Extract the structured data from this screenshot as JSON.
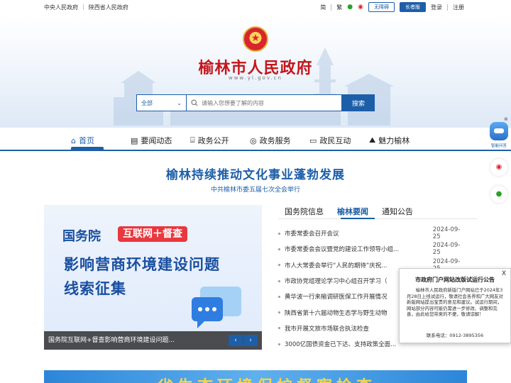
{
  "topbar": {
    "links": [
      "中央人民政府",
      "陕西省人民政府"
    ],
    "lang_simplified": "简",
    "lang_traditional": "繁",
    "icons": [
      "wechat-icon",
      "weibo-icon"
    ],
    "accessibility": "无障碍",
    "elderly": "长者版",
    "login": "登录",
    "register": "注册"
  },
  "header": {
    "site_title": "榆林市人民政府",
    "site_url": "www.yl.gov.cn",
    "search": {
      "scope": "全部",
      "placeholder": "请输入您想要了解的内容",
      "button": "搜索"
    }
  },
  "nav": {
    "items": [
      {
        "label": "首页",
        "icon": "home-icon"
      },
      {
        "label": "要闻动态",
        "icon": "news-icon"
      },
      {
        "label": "政务公开",
        "icon": "gov-icon"
      },
      {
        "label": "政务服务",
        "icon": "service-icon"
      },
      {
        "label": "政民互动",
        "icon": "chat-icon"
      },
      {
        "label": "魅力榆林",
        "icon": "scenery-icon"
      }
    ],
    "active_index": 0
  },
  "main": {
    "headline": "榆林持续推动文化事业蓬勃发展",
    "subhead": "中共榆林市委五届七次全会举行"
  },
  "feature": {
    "line1": "国务院",
    "pill": "互联网＋督查",
    "line2": "影响营商环境建设问题",
    "line3": "线索征集",
    "caption": "国务院互联网+督查影响营商环境建设问题...",
    "prev": "‹",
    "next": "›"
  },
  "news": {
    "tabs": [
      "国务院信息",
      "榆林要闻",
      "通知公告"
    ],
    "active_tab": 1,
    "items": [
      {
        "title": "市委常委会召开会议",
        "date": "2024-09-25"
      },
      {
        "title": "市委常委会会议暨党的建设工作领导小组...",
        "date": "2024-09-25"
      },
      {
        "title": "市人大常委会举行“人民的期待”庆祝...",
        "date": "2024-09-25"
      },
      {
        "title": "市政协党组理论学习中心组召开学习（",
        "date": ""
      },
      {
        "title": "黄华波一行来榆调研医保工作开展情况",
        "date": ""
      },
      {
        "title": "陕西省第十六届动物生态学与野生动物",
        "date": ""
      },
      {
        "title": "我市开展文旅市场联合执法检查",
        "date": ""
      },
      {
        "title": "3000亿国债资金已下达、支持政策全面...",
        "date": ""
      }
    ]
  },
  "bottom_banner": {
    "text": "省生态环境保护督察检查"
  },
  "sidebar": {
    "robot_label": "智能问答",
    "close": "⊗",
    "icons": [
      "robot-icon",
      "weibo-icon",
      "wechat-icon"
    ]
  },
  "notice": {
    "close": "X",
    "title": "市政府门户网站改版试运行公告",
    "body": "榆林市人民政府新版门户网站已于2024年3月28日上线试运行，敬请社会各界和广大网友对新版网站提出宝贵的意见和建议。试运行期间，网站部分内容可能仍需进一步修改、调整和完善，由此给您带来的不便，敬请谅解！",
    "tel": "联系电话：0912-3895356"
  },
  "colors": {
    "primary": "#1d5ea8",
    "title_red": "#c4161c",
    "accent_red": "#e8373e"
  }
}
